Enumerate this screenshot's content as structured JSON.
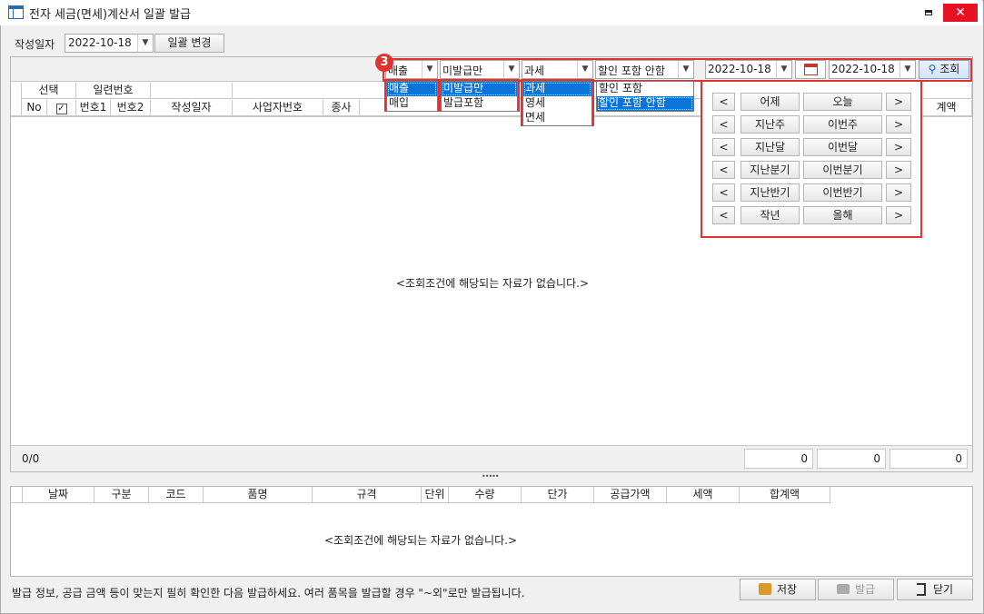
{
  "window": {
    "title": "전자 세금(면세)계산서 일괄 발급",
    "close_glyph": "✕"
  },
  "toolbar": {
    "date_label": "작성일자",
    "date_value": "2022-10-18",
    "bulk_change_label": "일괄 변경"
  },
  "filters": {
    "badge": "3",
    "type": {
      "value": "매출",
      "options": [
        "매출",
        "매입"
      ]
    },
    "issue": {
      "value": "미발급만",
      "options": [
        "미발급만",
        "발급포함"
      ]
    },
    "tax": {
      "value": "과세",
      "options": [
        "과세",
        "영세",
        "면세"
      ]
    },
    "discount": {
      "value": "할인 포함 안함",
      "options": [
        "할인 포함",
        "할인 포함 안함"
      ]
    },
    "date_from": "2022-10-18",
    "date_to": "2022-10-18",
    "search_label": "조회"
  },
  "date_panel": {
    "rows": [
      [
        "어제",
        "오늘"
      ],
      [
        "지난주",
        "이번주"
      ],
      [
        "지난달",
        "이번달"
      ],
      [
        "지난분기",
        "이번분기"
      ],
      [
        "지난반기",
        "이번반기"
      ],
      [
        "작년",
        "올해"
      ]
    ],
    "prev": "<",
    "next": ">"
  },
  "main_grid": {
    "group_select": "선택",
    "group_serial": "일련번호",
    "col_no": "No",
    "col_num1": "번호1",
    "col_num2": "번호2",
    "col_date": "작성일자",
    "col_bizno": "사업자번호",
    "col_type": "종사",
    "col_total_partial": "계액",
    "empty": "<조회조건에 해당되는 자료가 없습니다.>",
    "count": "0/0",
    "sums": [
      "0",
      "0",
      "0"
    ]
  },
  "splitter": "•••••",
  "detail_grid": {
    "columns": [
      "날짜",
      "구분",
      "코드",
      "품명",
      "규격",
      "단위",
      "수량",
      "단가",
      "공급가액",
      "세액",
      "합계액"
    ],
    "empty": "<조회조건에 해당되는 자료가 없습니다.>"
  },
  "footer": {
    "notice": "발급 정보, 공급 금액 등이 맞는지 필히 확인한 다음 발급하세요. 여러 품목을 발급할 경우 \"~외\"로만 발급됩니다.",
    "save": "저장",
    "issue": "발급",
    "close": "닫기"
  }
}
